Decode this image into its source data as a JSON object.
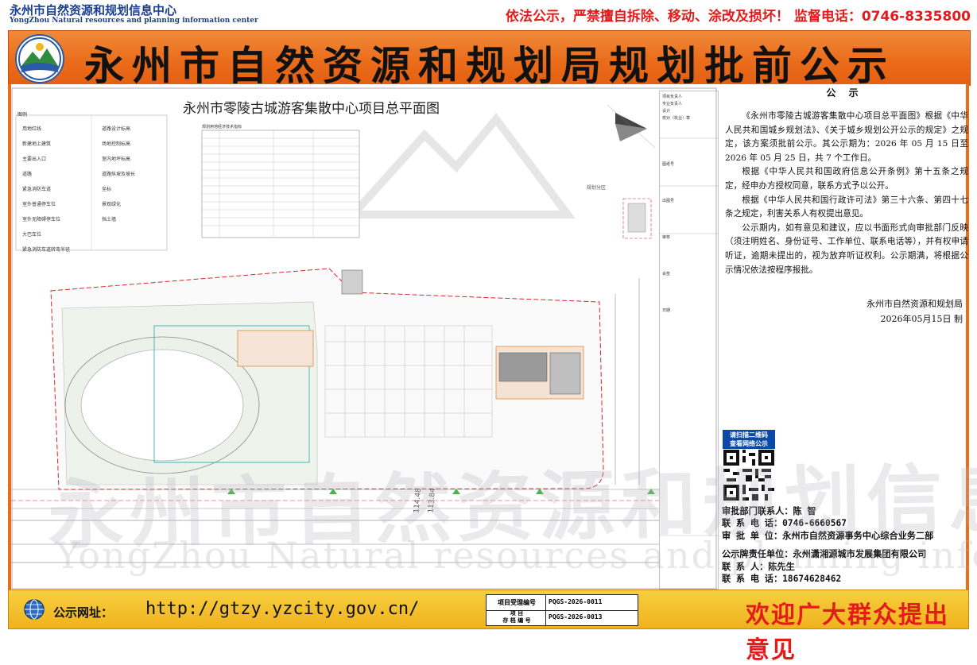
{
  "header": {
    "org_name_cn": "永州市自然资源和规划信息中心",
    "org_name_en": "YongZhou Natural resources and planning information center",
    "warning": "依法公示，严禁擅自拆除、移动、涂改及损坏！ 监督电话：0746-8335800",
    "banner_title": "永州市自然资源和规划局规划批前公示"
  },
  "drawing": {
    "title": "永州市零陵古城游客集散中心项目总平面图",
    "legend_title": "图例",
    "legend_items": [
      [
        "用地红线",
        "道路设计标高"
      ],
      [
        "新建地上建筑",
        "场地控制标高"
      ],
      [
        "主要出入口",
        "室内地坪标高"
      ],
      [
        "道路",
        "道路纵坡及坡长"
      ],
      [
        "紧急消防车道",
        "坐标"
      ],
      [
        "室外普通停车位",
        "景观绿化"
      ],
      [
        "室外无障碍停车位",
        ""
      ],
      [
        "大巴车位",
        ""
      ],
      [
        "紧急消防车道转弯半径",
        "挡土墙"
      ]
    ],
    "stats_title": "规划用地经济技术指标",
    "north_label": "规划分区",
    "dims": [
      "114.48",
      "113.84"
    ]
  },
  "titleblock": {
    "rows": [
      "项目负责人",
      "专业负责人",
      "设计",
      "校对（执业）章",
      "图纸号",
      "出图号",
      "审核",
      "会签",
      "日期"
    ]
  },
  "notice": {
    "heading": "公  示",
    "paragraphs": [
      "《永州市零陵古城游客集散中心项目总平面图》根据《中华人民共和国城乡规划法》、《关于城乡规划公开公示的规定》之规定，该方案须批前公示。其公示期为：2026 年 05 月 15 日至 2026 年 05 月 25 日，共 7 个工作日。",
      "根据《中华人民共和国政府信息公开条例》第十五条之规定，经申办方授权同意，联系方式予以公开。",
      "根据《中华人民共和国行政许可法》第三十六条、第四十七条之规定，利害关系人有权提出意见。",
      "公示期内，如有意见和建议，应以书面形式向审批部门反映（须注明姓名、身份证号、工作单位、联系电话等），并有权申请听证，逾期未提出的，视为放弃听证权利。公示期满，将根据公示情况依法按程序报批。"
    ],
    "sign_org": "永州市自然资源和规划局",
    "sign_date": "2026年05月15日  制"
  },
  "qr": {
    "caption_line1": "请扫描二维码",
    "caption_line2": "查看网络公示"
  },
  "contacts": {
    "approval_contact": "审批部门联系人：陈   智",
    "approval_phone": "联  系  电  话：0746-6660567",
    "approval_unit": "审  批  单  位：永州市自然资源事务中心综合业务二部",
    "sign_unit": "公示牌责任单位：永州潇湘源城市发展集团有限公司",
    "sign_contact": "联    系    人：陈先生",
    "sign_phone": "联  系  电  话：18674628462"
  },
  "footer": {
    "site_label": "公示网址：",
    "site_url": "http://gtzy.yzcity.gov.cn/",
    "code_label1": "项目受理编号",
    "code_value1": "PQGS-2026-0011",
    "code_label2a": "项    目",
    "code_label2b": "存  档  编  号",
    "code_value2": "PQGS-2026-0013",
    "welcome": "欢迎广大群众提出意见"
  },
  "watermark": {
    "cn": "永州市自然资源和规划信息中心",
    "en": "YongZhou Natural resources and planning information center"
  },
  "colors": {
    "banner_orange": "#ea6d1b",
    "warning_red": "#e41b1b",
    "org_blue": "#1b3f8f",
    "footer_yellow": "#f0b21e",
    "red_line": "#d9262a",
    "green_area": "#c9e5c0"
  }
}
